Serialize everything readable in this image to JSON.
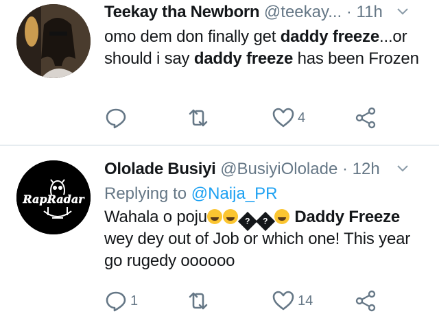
{
  "tweets": [
    {
      "name": "Teekay tha Newborn",
      "handle": "@teekay...",
      "dot": "·",
      "time": "11h",
      "text_parts": [
        "omo dem don finally get ",
        "daddy freeze",
        "...or should i say ",
        "daddy freeze",
        " has been Frozen"
      ],
      "replies": "",
      "retweets": "",
      "likes": "4"
    },
    {
      "name": "Ololade Busiyi",
      "handle": "@BusiyiOlolade",
      "dot": "·",
      "time": "12h",
      "replying_prefix": "Replying to ",
      "replying_to": "@Naija_PR",
      "text_start": "Wahala o poju",
      "text_bold": "Daddy Freeze",
      "text_end": "wey dey out of Job or which one! This year go rugedy oooooo",
      "replacement_char": "?",
      "replies": "1",
      "retweets": "",
      "likes": "14",
      "avatar_logo_text": "RapRadar"
    }
  ],
  "icons": {
    "reply": "reply-bubble-icon",
    "retweet": "retweet-icon",
    "like": "heart-icon",
    "share": "share-icon",
    "menu": "chevron-down-icon"
  },
  "colors": {
    "text": "#14171a",
    "secondary": "#657786",
    "link": "#1da1f2",
    "divider": "#e6ecf0"
  }
}
